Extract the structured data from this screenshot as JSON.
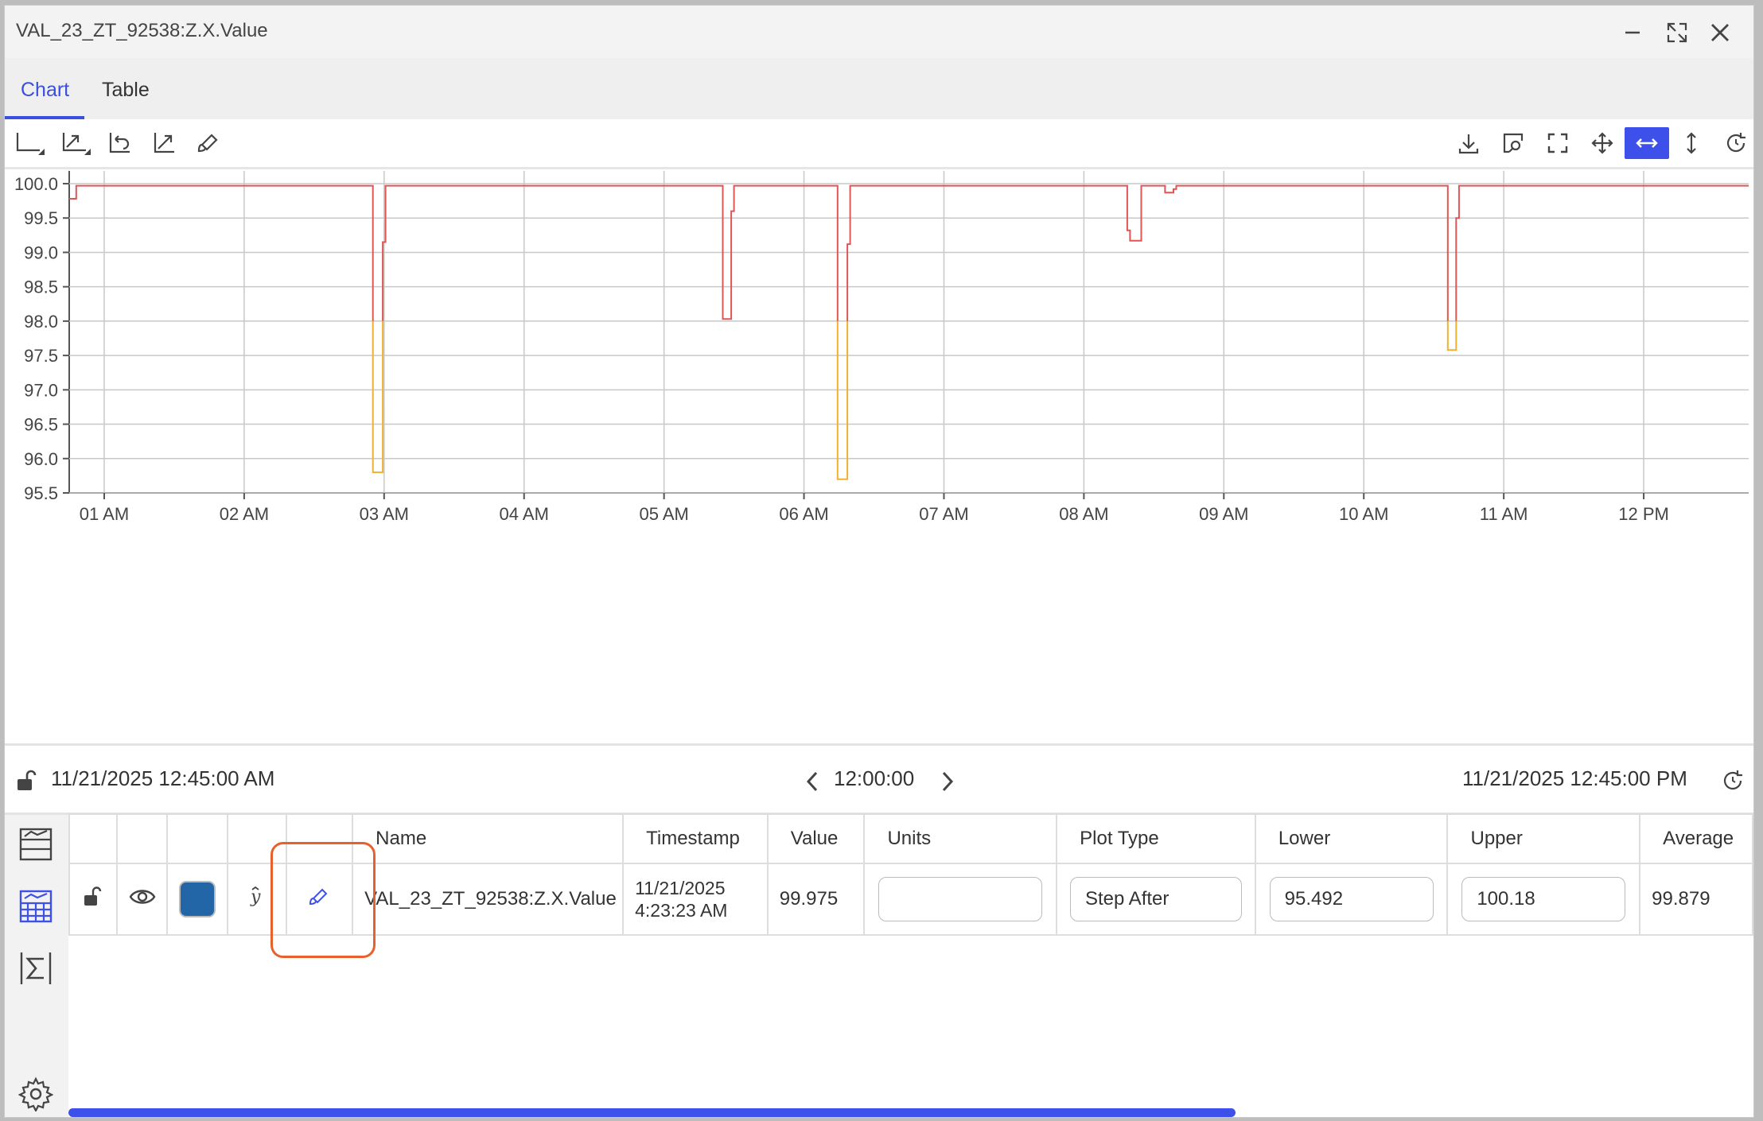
{
  "window": {
    "title": "VAL_23_ZT_92538:Z.X.Value"
  },
  "tabs": [
    {
      "label": "Chart"
    },
    {
      "label": "Table"
    }
  ],
  "chart_data": {
    "type": "line",
    "step": "after",
    "ylim": [
      95.5,
      100.0
    ],
    "yticks": [
      "95.5",
      "96.0",
      "96.5",
      "97.0",
      "97.5",
      "98.0",
      "98.5",
      "99.0",
      "99.5",
      "100.0"
    ],
    "xticks": [
      "01 AM",
      "02 AM",
      "03 AM",
      "04 AM",
      "05 AM",
      "06 AM",
      "07 AM",
      "08 AM",
      "09 AM",
      "10 AM",
      "11 AM",
      "12 PM"
    ],
    "xrange_hours": [
      0.75,
      12.75
    ],
    "thresholds": {
      "lower": 98.0
    },
    "grid": true,
    "colors": {
      "normal": "#e05555",
      "below_lower": "#f0b030"
    },
    "series": [
      {
        "x": [
          0.75,
          0.8,
          0.8,
          2.92,
          2.92,
          2.99,
          2.99,
          3.01,
          3.01,
          5.42,
          5.42,
          5.48,
          5.48,
          5.5,
          5.5,
          6.24,
          6.24,
          6.31,
          6.31,
          6.33,
          6.33,
          8.31,
          8.31,
          8.33,
          8.33,
          8.41,
          8.41,
          8.58,
          8.58,
          8.64,
          8.64,
          8.66,
          8.66,
          10.6,
          10.6,
          10.66,
          10.66,
          10.68,
          10.68,
          12.75
        ],
        "y": [
          99.78,
          99.78,
          99.97,
          99.97,
          95.8,
          95.8,
          99.15,
          99.15,
          99.97,
          99.97,
          98.03,
          98.03,
          99.6,
          99.6,
          99.97,
          99.97,
          95.7,
          95.7,
          99.12,
          99.12,
          99.97,
          99.97,
          99.32,
          99.32,
          99.17,
          99.17,
          99.97,
          99.97,
          99.87,
          99.87,
          99.92,
          99.92,
          99.97,
          99.97,
          97.58,
          97.58,
          99.5,
          99.5,
          99.97,
          99.97
        ]
      }
    ]
  },
  "timebar": {
    "start": "11/21/2025 12:45:00 AM",
    "duration": "12:00:00",
    "end": "11/21/2025 12:45:00 PM"
  },
  "table": {
    "headers": [
      "Name",
      "Timestamp",
      "Value",
      "Units",
      "Plot Type",
      "Lower",
      "Upper",
      "Average"
    ],
    "row": {
      "name": "VAL_23_ZT_92538:Z.X.Value",
      "timestamp_date": "11/21/2025",
      "timestamp_time": "4:23:23 AM",
      "value": "99.975",
      "units": "",
      "plot_type": "Step After",
      "lower": "95.492",
      "upper": "100.18",
      "average": "99.879",
      "color": "#2366a8"
    }
  },
  "colors": {
    "accent": "#3d50ea",
    "highlight": "#e8602c"
  }
}
